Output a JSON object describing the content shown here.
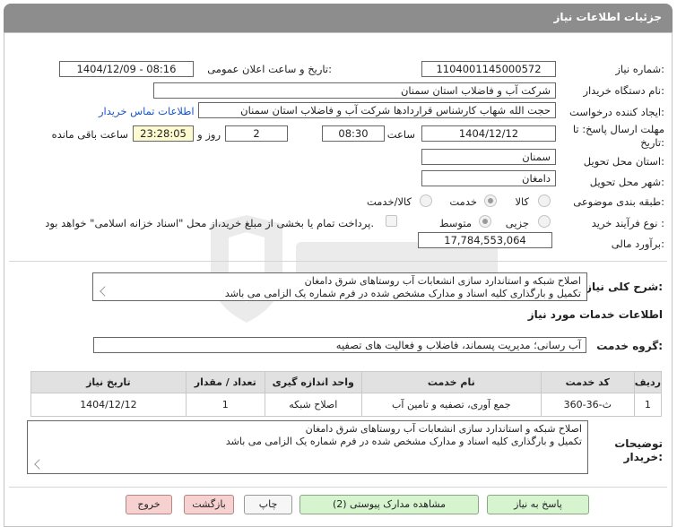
{
  "header": {
    "title": "جزئیات اطلاعات نیاز"
  },
  "fields": {
    "need_number_label": "شماره نیاز:",
    "need_number": "1104001145000572",
    "announce_label": "تاریخ و ساعت اعلان عمومی:",
    "announce_value": "1404/12/09 - 08:16",
    "buyer_org_label": "نام دستگاه خریدار:",
    "buyer_org": "شرکت آب و فاضلاب استان سمنان",
    "creator_label": "ایجاد کننده درخواست:",
    "creator": "حجت الله شهاب کارشناس قراردادها شرکت آب و فاضلاب استان سمنان",
    "contact_link": "اطلاعات تماس خریدار",
    "deadline_label": "مهلت ارسال پاسخ: تا",
    "deadline_label2": "تاریخ:",
    "deadline_date": "1404/12/12",
    "time_label": "ساعت",
    "deadline_time": "08:30",
    "days_value": "2",
    "days_label": "روز و",
    "remaining_value": "23:28:05",
    "remaining_label": "ساعت باقی مانده",
    "province_label": "استان محل تحویل:",
    "province": "سمنان",
    "city_label": "شهر محل تحویل:",
    "city": "دامغان",
    "category_label": "طبقه بندی موضوعی:",
    "cat_goods": "کالا",
    "cat_service": "خدمت",
    "cat_goods_service": "کالا/خدمت",
    "process_label": "نوع فرآیند خرید :",
    "proc_partial": "جزیی",
    "proc_medium": "متوسط",
    "payment_note": "پرداخت تمام یا بخشی از مبلغ خرید،از محل \"اسناد خزانه اسلامی\" خواهد بود.",
    "budget_label": "برآورد مالی:",
    "budget": "17,784,553,064"
  },
  "summary": {
    "label": "شرح کلی نیاز:",
    "line1": "اصلاح شبکه  و استاندارد سازی انشعابات آب روستاهای شرق دامغان",
    "line2": "تکمیل و بارگذاری کلیه اسناد و مدارک مشخص شده در فرم شماره یک الزامی می باشد"
  },
  "services": {
    "title": "اطلاعات خدمات مورد نیاز",
    "group_label": "گروه خدمت:",
    "group_value": "آب رسانی؛ مدیریت پسماند، فاضلاب و فعالیت های تصفیه"
  },
  "table": {
    "headers": [
      "ردیف",
      "کد خدمت",
      "نام خدمت",
      "واحد اندازه گیری",
      "تعداد / مقدار",
      "تاریخ نیاز"
    ],
    "rows": [
      [
        "1",
        "ث-36-360",
        "جمع آوری، تصفیه و تامین آب",
        "اصلاح شبکه",
        "1",
        "1404/12/12"
      ]
    ]
  },
  "buyer_notes": {
    "label1": "توضیحات",
    "label2": "خریدار:",
    "line1": "اصلاح شبکه  و استاندارد سازی انشعابات آب روستاهای شرق دامغان",
    "line2": "تکمیل و بارگذاری کلیه اسناد و مدارک مشخص شده در فرم شماره یک الزامی می باشد"
  },
  "buttons": {
    "reply": "پاسخ به نیاز",
    "docs": "مشاهده مدارک پیوستی (2)",
    "print": "چاپ",
    "back": "بازگشت",
    "exit": "خروج"
  },
  "icons": {
    "watermark": "aria-tender-shield-icon",
    "resize": "resize-handle-icon"
  }
}
